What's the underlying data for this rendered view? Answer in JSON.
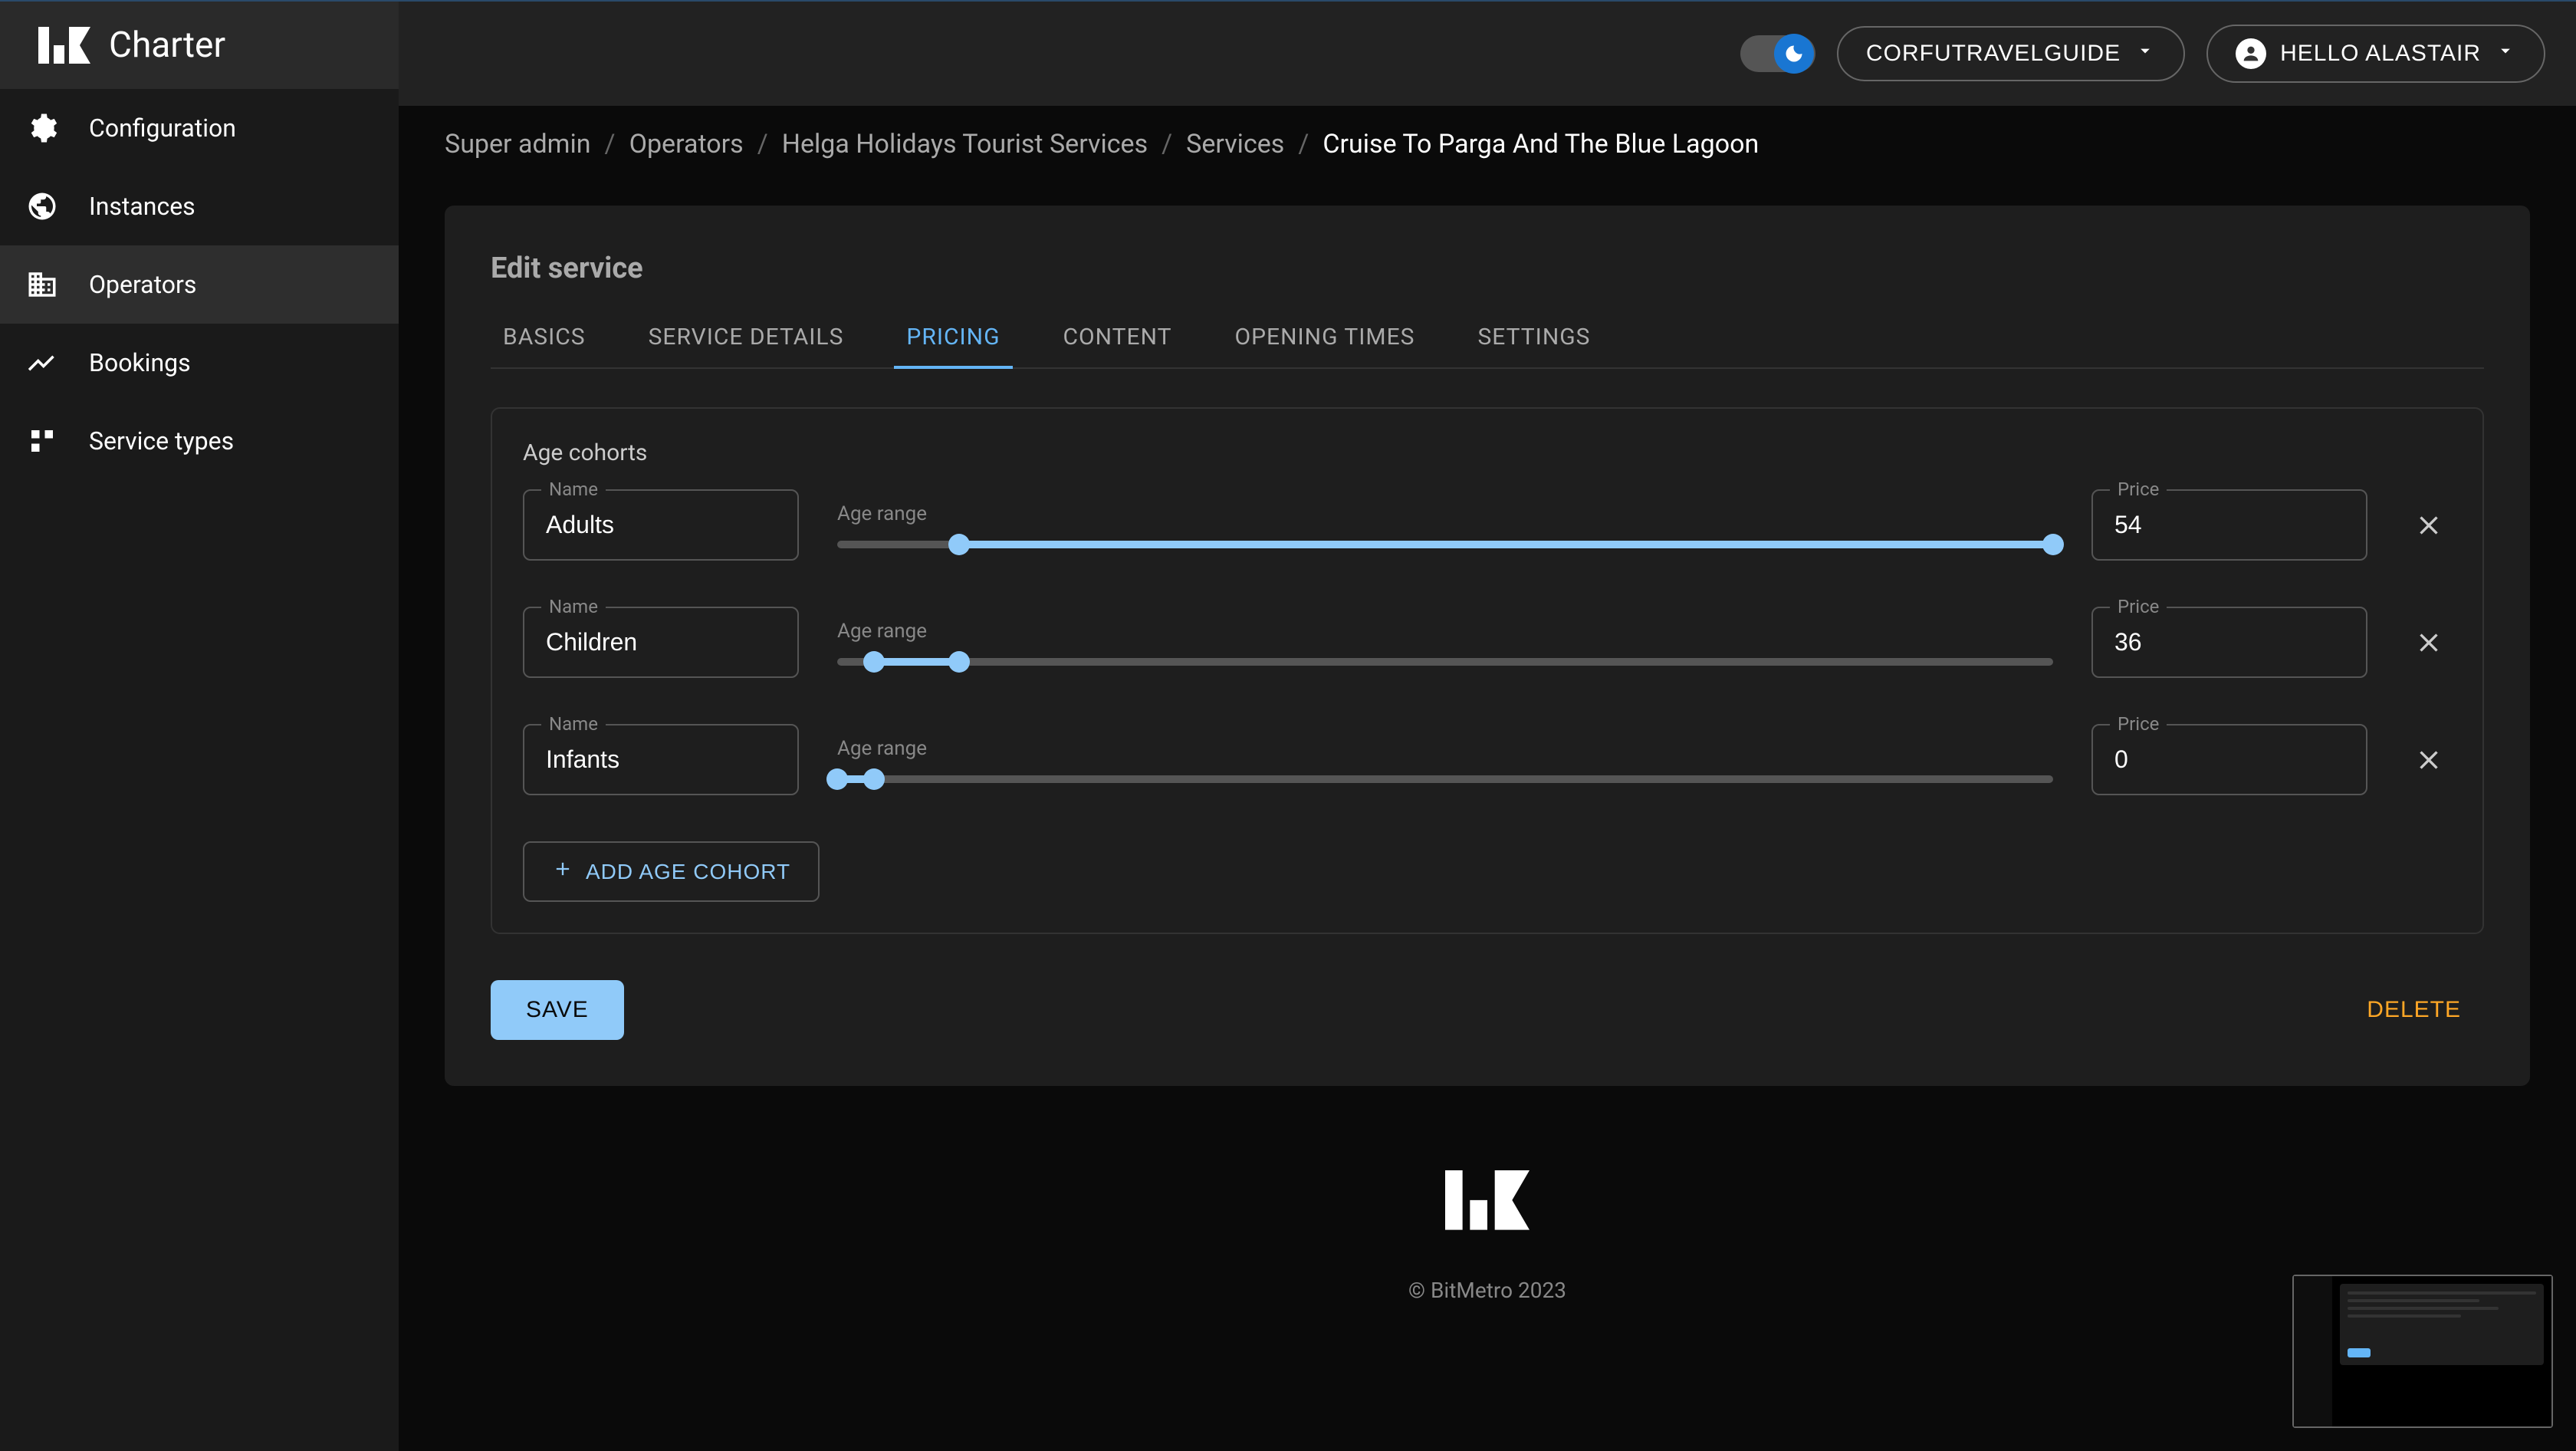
{
  "brand": {
    "title": "Charter"
  },
  "sidebar": {
    "items": [
      {
        "label": "Configuration",
        "icon": "gear"
      },
      {
        "label": "Instances",
        "icon": "globe"
      },
      {
        "label": "Operators",
        "icon": "business"
      },
      {
        "label": "Bookings",
        "icon": "analytics"
      },
      {
        "label": "Service types",
        "icon": "category"
      }
    ]
  },
  "topbar": {
    "instance_label": "CORFUTRAVELGUIDE",
    "user_label": "HELLO ALASTAIR"
  },
  "breadcrumb": {
    "items": [
      "Super admin",
      "Operators",
      "Helga Holidays Tourist Services",
      "Services"
    ],
    "current": "Cruise To Parga And The Blue Lagoon"
  },
  "page": {
    "title": "Edit service"
  },
  "tabs": [
    "BASICS",
    "SERVICE DETAILS",
    "PRICING",
    "CONTENT",
    "OPENING TIMES",
    "SETTINGS"
  ],
  "pricing": {
    "section_label": "Age cohorts",
    "name_label": "Name",
    "range_label": "Age range",
    "price_label": "Price",
    "cohorts": [
      {
        "name": "Adults",
        "price": "54",
        "range_start": 10,
        "range_end": 100
      },
      {
        "name": "Children",
        "price": "36",
        "range_start": 3,
        "range_end": 10
      },
      {
        "name": "Infants",
        "price": "0",
        "range_start": 0,
        "range_end": 3
      }
    ],
    "add_label": "ADD AGE COHORT"
  },
  "actions": {
    "save": "SAVE",
    "delete": "DELETE"
  },
  "footer": {
    "copyright": "© BitMetro 2023"
  }
}
